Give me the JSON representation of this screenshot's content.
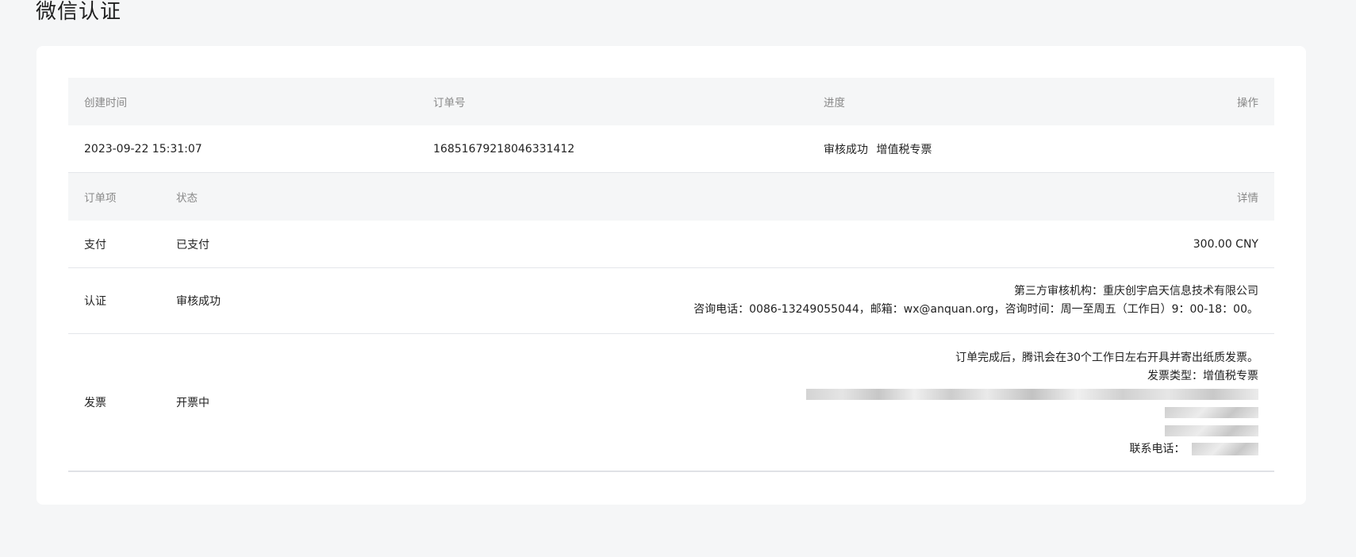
{
  "page": {
    "title": "微信认证"
  },
  "order_table": {
    "headers": {
      "created": "创建时间",
      "order_no": "订单号",
      "progress": "进度",
      "action": "操作"
    },
    "row": {
      "created": "2023-09-22 15:31:07",
      "order_no": "16851679218046331412",
      "progress": "审核成功",
      "invoice_type_tag": "增值税专票"
    }
  },
  "items_table": {
    "headers": {
      "item": "订单项",
      "status": "状态",
      "detail": "详情"
    },
    "payment": {
      "item": "支付",
      "status": "已支付",
      "detail": "300.00 CNY"
    },
    "certification": {
      "item": "认证",
      "status": "审核成功",
      "detail_line1": "第三方审核机构：重庆创宇启天信息技术有限公司",
      "detail_line2": "咨询电话：0086-13249055044，邮箱：wx@anquan.org，咨询时间：周一至周五（工作日）9：00-18：00。"
    },
    "invoice": {
      "item": "发票",
      "status": "开票中",
      "detail_line1": "订单完成后，腾讯会在30个工作日左右开具并寄出纸质发票。",
      "detail_line2": "发票类型：增值税专票",
      "contact_label": "联系电话："
    }
  }
}
